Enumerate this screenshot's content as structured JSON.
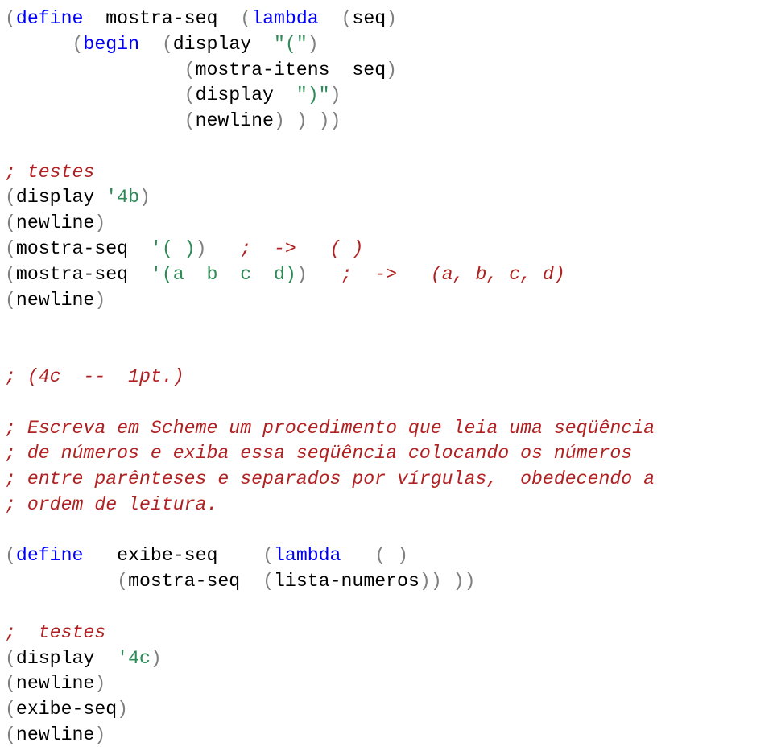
{
  "tokens": {
    "t01": "(",
    "t02": "define",
    "t03": "  mostra-seq  ",
    "t04": "(",
    "t05": "lambda",
    "t06": "  ",
    "t07": "(",
    "t08": "seq",
    "t09": ")",
    "t10": "      ",
    "t11": "(",
    "t12": "begin",
    "t13": "  ",
    "t14": "(",
    "t15": "display",
    "t16": "  ",
    "t17": "\"(\"",
    "t18": ")",
    "t19": "                ",
    "t20": "(",
    "t21": "mostra-itens  seq",
    "t22": ")",
    "t23": "                ",
    "t24": "(",
    "t25": "display",
    "t26": "  ",
    "t27": "\")\"",
    "t28": ")",
    "t29": "                ",
    "t30": "(",
    "t31": "newline",
    "t32": ") ) ))",
    "c01": "; testes",
    "t33": "(",
    "t34": "display",
    "t35": " ",
    "t36": "'4b",
    "t37": ")",
    "t38": "(",
    "t39": "newline",
    "t40": ")",
    "t41": "(",
    "t42": "mostra-seq",
    "t43": "  ",
    "t44": "'( )",
    "t45": ")   ",
    "c02": ";  ->   ( )",
    "t46": "(",
    "t47": "mostra-seq",
    "t48": "  ",
    "t49": "'(a  b  c  d)",
    "t50": ")   ",
    "c03": ";  ->   (a, b, c, d)",
    "t51": "(",
    "t52": "newline",
    "t53": ")",
    "c04": "; (4c  --  1pt.)",
    "c05": "; Escreva em Scheme um procedimento que leia uma seqüência",
    "c06": "; de números e exiba essa seqüência colocando os números",
    "c07": "; entre parênteses e separados por vírgulas,  obedecendo a",
    "c08": "; ordem de leitura.",
    "t54": "(",
    "t55": "define",
    "t56": "   exibe-seq    ",
    "t57": "(",
    "t58": "lambda",
    "t59": "   ",
    "t60": "( )",
    "t61": "          ",
    "t62": "(",
    "t63": "mostra-seq",
    "t64": "  ",
    "t65": "(",
    "t66": "lista-numeros",
    "t67": ")) ))",
    "c09": ";  testes",
    "t68": "(",
    "t69": "display",
    "t70": "  ",
    "t71": "'4c",
    "t72": ")",
    "t73": "(",
    "t74": "newline",
    "t75": ")",
    "t76": "(",
    "t77": "exibe-seq",
    "t78": ")",
    "t79": "(",
    "t80": "newline",
    "t81": ")"
  }
}
